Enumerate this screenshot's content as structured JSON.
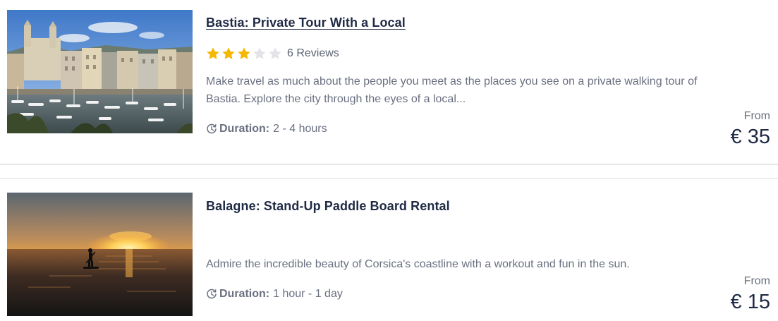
{
  "listings": [
    {
      "title": "Bastia: Private Tour With a Local",
      "rating": 3,
      "rating_max": 5,
      "reviews": "6 Reviews",
      "description": "Make travel as much about the people you meet as the places you see on a private walking tour of Bastia. Explore the city through the eyes of a local...",
      "duration_label": "Duration:",
      "duration_value": "2 - 4 hours",
      "from_label": "From",
      "price": "€ 35"
    },
    {
      "title": "Balagne: Stand-Up Paddle Board Rental",
      "description": "Admire the incredible beauty of Corsica's coastline with a workout and fun in the sun.",
      "duration_label": "Duration:",
      "duration_value": "1 hour - 1 day",
      "from_label": "From",
      "price": "€ 15"
    }
  ],
  "colors": {
    "star_filled": "#f5b800",
    "star_empty": "#e3e4e7",
    "title": "#1f2a44",
    "body_text": "#6a7080"
  }
}
